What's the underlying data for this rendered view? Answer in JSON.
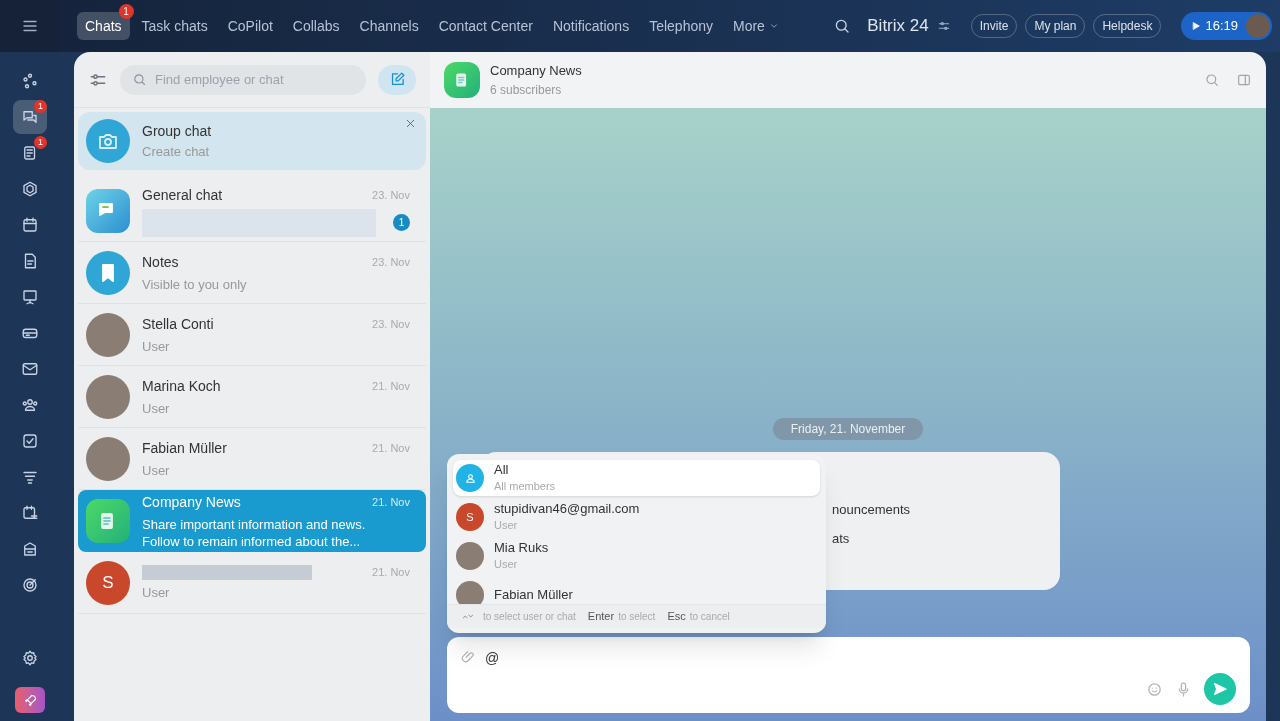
{
  "top_nav": {
    "tabs": [
      {
        "label": "Chats",
        "selected": true,
        "badge": "1"
      },
      {
        "label": "Task chats",
        "selected": false
      },
      {
        "label": "CoPilot",
        "selected": false
      },
      {
        "label": "Collabs",
        "selected": false
      },
      {
        "label": "Channels",
        "selected": false
      },
      {
        "label": "Contact Center",
        "selected": false
      },
      {
        "label": "Notifications",
        "selected": false
      },
      {
        "label": "Telephony",
        "selected": false
      },
      {
        "label": "More",
        "selected": false,
        "dropdown": true
      }
    ],
    "brand": "Bitrix 24",
    "buttons": [
      "Invite",
      "My plan",
      "Helpdesk"
    ],
    "time": "16:19"
  },
  "sidebar": {
    "items": [
      {
        "kind": "network",
        "selected": false
      },
      {
        "kind": "chat",
        "selected": true,
        "badge": "1"
      },
      {
        "kind": "feed",
        "selected": false,
        "badge": "1"
      },
      {
        "kind": "hexagon",
        "selected": false
      },
      {
        "kind": "calendar",
        "selected": false
      },
      {
        "kind": "document",
        "selected": false
      },
      {
        "kind": "board",
        "selected": false
      },
      {
        "kind": "drive",
        "selected": false
      },
      {
        "kind": "mail",
        "selected": false
      },
      {
        "kind": "people",
        "selected": false
      },
      {
        "kind": "task",
        "selected": false
      },
      {
        "kind": "funnel",
        "selected": false
      },
      {
        "kind": "schedule",
        "selected": false
      },
      {
        "kind": "store",
        "selected": false
      },
      {
        "kind": "target",
        "selected": false
      }
    ],
    "bottom_items": [
      {
        "kind": "settings"
      },
      {
        "kind": "rocket"
      }
    ]
  },
  "chat_list": {
    "search": {
      "placeholder": "Find employee or chat"
    },
    "banner": {
      "title": "Group chat",
      "subtitle": "Create chat"
    },
    "chats": [
      {
        "kind": "general",
        "name": "General chat",
        "date": "23. Nov",
        "hidden_preview": true,
        "unread": "1",
        "selected": false
      },
      {
        "kind": "notes",
        "name": "Notes",
        "preview": "Visible to you only",
        "date": "23. Nov",
        "selected": false
      },
      {
        "kind": "photo",
        "name": "Stella Conti",
        "preview": "User",
        "date": "23. Nov",
        "selected": false
      },
      {
        "kind": "photo",
        "name": "Marina Koch",
        "preview": "User",
        "date": "21. Nov",
        "selected": false
      },
      {
        "kind": "photo",
        "name": "Fabian Müller",
        "preview": "User",
        "date": "21. Nov",
        "selected": false
      },
      {
        "kind": "news",
        "name": "Company News",
        "preview": "Share important information and news. Follow to remain informed about the...",
        "date": "21. Nov",
        "selected": true
      },
      {
        "kind": "letter",
        "letter": "S",
        "hidden_name": true,
        "preview": "User",
        "date": "21. Nov",
        "selected": false
      }
    ]
  },
  "chat": {
    "title": "Company News",
    "subtitle": "6 subscribers",
    "date_divider": "Friday, 21. November",
    "message_fragments": [
      "nouncements",
      "ats"
    ],
    "mention_popup": {
      "items": [
        {
          "kind": "group",
          "name": "All",
          "subtitle": "All members",
          "selected": true
        },
        {
          "kind": "letter",
          "letter": "S",
          "name": "stupidivan46@gmail.com",
          "subtitle": "User",
          "selected": false
        },
        {
          "kind": "photo",
          "name": "Mia Ruks",
          "subtitle": "User",
          "selected": false
        },
        {
          "kind": "photo",
          "name": "Fabian Müller",
          "selected": false
        }
      ],
      "hints": [
        {
          "text": "to select user or chat",
          "arrows": true
        },
        {
          "key": "Enter",
          "text": "to select"
        },
        {
          "key": "Esc",
          "text": "to cancel"
        }
      ]
    },
    "composer": {
      "value": "@"
    }
  }
}
